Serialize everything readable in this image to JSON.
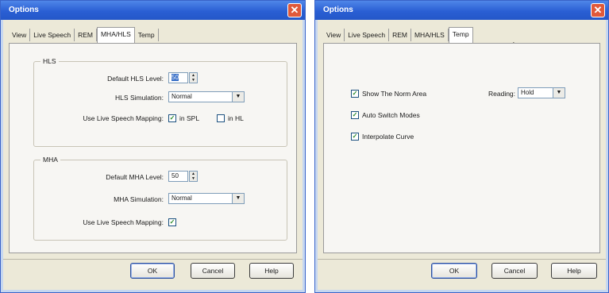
{
  "colors": {
    "titlebar": "#2a5fd4",
    "dialog_bg": "#ece9d8",
    "close": "#e0593a"
  },
  "dialog1": {
    "title": "Options",
    "tabs": [
      "View",
      "Live Speech",
      "REM",
      "MHA/HLS",
      "Temp"
    ],
    "selected_tab": "MHA/HLS",
    "hls": {
      "group_title": "HLS",
      "level_label": "Default HLS Level:",
      "level_value": "50",
      "sim_label": "HLS Simulation:",
      "sim_value": "Normal",
      "mapping_label": "Use Live Speech Mapping:",
      "spl_label": "in SPL",
      "spl_checked": true,
      "hl_label": "in HL",
      "hl_checked": false
    },
    "mha": {
      "group_title": "MHA",
      "level_label": "Default MHA Level:",
      "level_value": "50",
      "sim_label": "MHA Simulation:",
      "sim_value": "Normal",
      "mapping_label": "Use Live Speech Mapping:",
      "mapping_checked": true
    },
    "buttons": {
      "ok": "OK",
      "cancel": "Cancel",
      "help": "Help"
    }
  },
  "dialog2": {
    "title": "Options",
    "tabs": [
      "View",
      "Live Speech",
      "REM",
      "MHA/HLS",
      "Temp"
    ],
    "selected_tab": "Temp",
    "show_norm_area": "Show The Norm Area",
    "auto_switch": "Auto Switch Modes",
    "interpolate": "Interpolate Curve",
    "reading_label": "Reading:",
    "reading_value": "Hold",
    "buttons": {
      "ok": "OK",
      "cancel": "Cancel",
      "help": "Help"
    }
  },
  "check_mark": "✓",
  "icons": {
    "close": "close-icon",
    "arrow_up": "spin-up-icon",
    "arrow_down": "spin-down-icon",
    "dropdown": "chevron-down-icon",
    "cursor": "mouse-pointer-icon"
  }
}
